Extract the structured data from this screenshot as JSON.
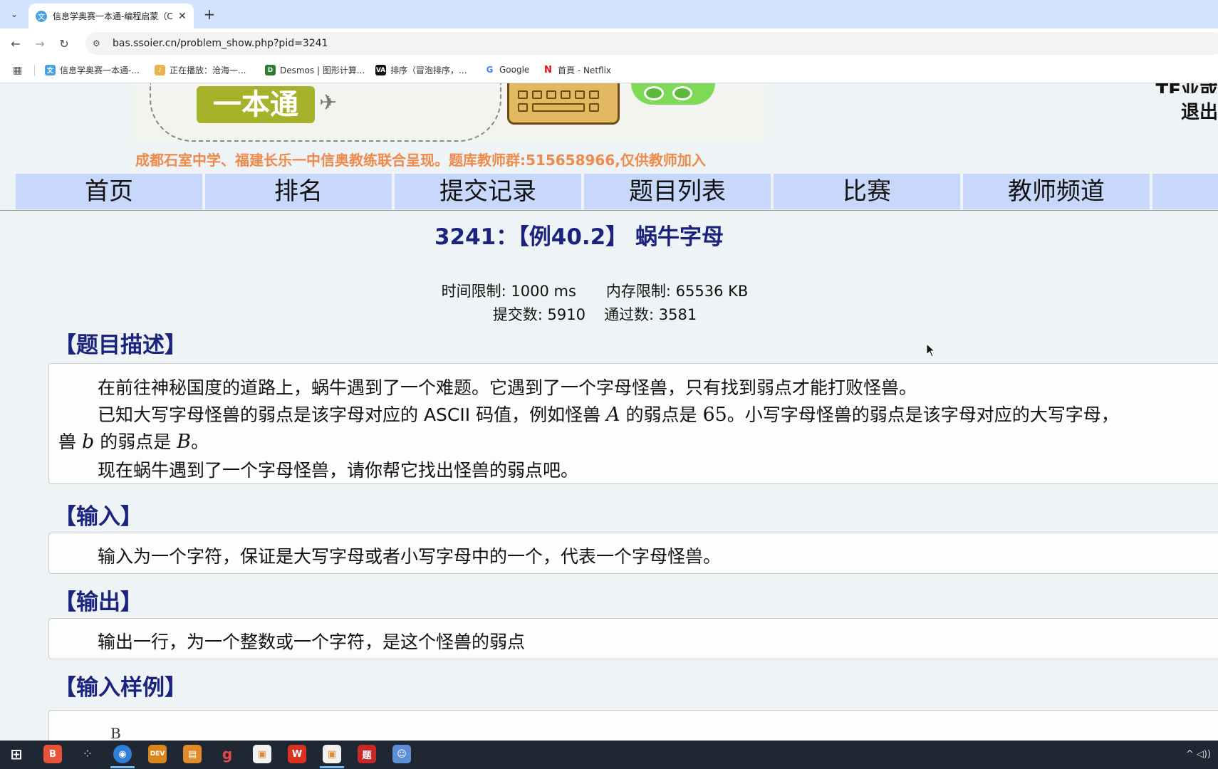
{
  "browser": {
    "tab_title": "信息学奥赛一本通-编程启蒙（C",
    "tab_close": "✕",
    "new_tab": "+",
    "url": "bas.ssoier.cn/problem_show.php?pid=3241",
    "bookmarks": [
      {
        "label": "信息学奥赛一本通-...",
        "color": "#4aa3df",
        "glyph": "文"
      },
      {
        "label": "正在播放：沧海一...",
        "color": "#e7b34a",
        "glyph": "♪"
      },
      {
        "label": "Desmos | 图形计算...",
        "color": "#2e7d32",
        "glyph": "D"
      },
      {
        "label": "排序（冒泡排序，...",
        "color": "#111111",
        "glyph": "VA"
      },
      {
        "label": "Google",
        "color": "#ffffff",
        "glyph": "G"
      },
      {
        "label": "首頁 - Netflix",
        "color": "#ffffff",
        "glyph": "N"
      }
    ]
  },
  "site": {
    "logo_text": "一本通",
    "user_line1": "TF业或",
    "logout": "退出",
    "slogan": "成都石室中学、福建长乐一中信奥教练联合呈现。题库教师群:515658966,仅供教师加入",
    "menu": [
      "首页",
      "排名",
      "提交记录",
      "题目列表",
      "比赛",
      "教师频道",
      ""
    ]
  },
  "problem": {
    "title": "3241：【例40.2】 蜗牛字母",
    "time_limit": "时间限制: 1000 ms",
    "memory_limit": "内存限制: 65536 KB",
    "submissions": "提交数: 5910",
    "accepted": "通过数: 3581",
    "desc_heading": "【题目描述】",
    "desc_line1": "在前往神秘国度的道路上，蜗牛遇到了一个难题。它遇到了一个字母怪兽，只有找到弱点才能打败怪兽。",
    "desc_line2_a": "已知大写字母怪兽的弱点是该字母对应的 ASCII 码值，例如怪兽 ",
    "desc_line2_m1": "A",
    "desc_line2_b": " 的弱点是 ",
    "desc_line2_m2": "65",
    "desc_line2_c": "。小写字母怪兽的弱点是该字母对应的大写字母，",
    "desc_line3_a": "兽 ",
    "desc_line3_m1": "b",
    "desc_line3_b": " 的弱点是 ",
    "desc_line3_m2": "B",
    "desc_line3_c": "。",
    "desc_line4": "现在蜗牛遇到了一个字母怪兽，请你帮它找出怪兽的弱点吧。",
    "input_heading": "【输入】",
    "input_text": "输入为一个字符，保证是大写字母或者小写字母中的一个，代表一个字母怪兽。",
    "output_heading": "【输出】",
    "output_text": "输出一行，为一个整数或一个字符，是这个怪兽的弱点",
    "sample_heading": "【输入样例】",
    "sample_input": "B"
  },
  "taskbar": {
    "start": "⊞",
    "apps": [
      {
        "name": "brave",
        "glyph": "B",
        "color": "#e8533a"
      },
      {
        "name": "dots",
        "glyph": "⁘",
        "color": "#1f2733"
      },
      {
        "name": "chrome",
        "glyph": "◉",
        "color": "#2f7fd6"
      },
      {
        "name": "devc",
        "glyph": "DEV",
        "color": "#d9871d"
      },
      {
        "name": "app5",
        "glyph": "▤",
        "color": "#e08a2a"
      },
      {
        "name": "app6",
        "glyph": "g",
        "color": "#1f2733"
      },
      {
        "name": "app7",
        "glyph": "▣",
        "color": "#f1f1f1"
      },
      {
        "name": "wps",
        "glyph": "W",
        "color": "#d9331f"
      },
      {
        "name": "app9",
        "glyph": "▣",
        "color": "#f1f1f1"
      },
      {
        "name": "app10",
        "glyph": "题",
        "color": "#c62828"
      },
      {
        "name": "app11",
        "glyph": "☺",
        "color": "#5d8fd6"
      }
    ],
    "tray": "^ ◁))"
  }
}
